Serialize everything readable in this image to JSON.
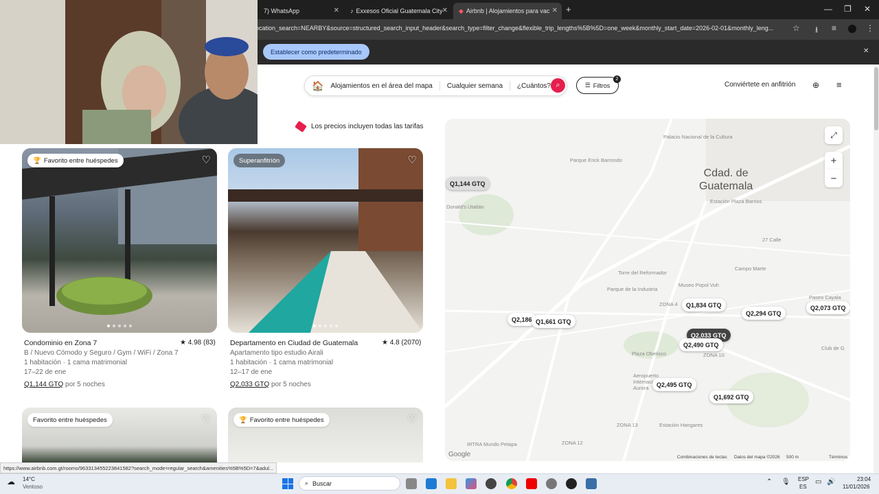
{
  "browser": {
    "tabs": [
      {
        "label": "7) WhatsApp",
        "active": false
      },
      {
        "label": "Exxesos Oficial Guatemala City",
        "active": false
      },
      {
        "label": "Airbnb | Alojamientos para vac",
        "active": true
      }
    ],
    "url": "ocation_search=NEARBY&source=structured_search_input_header&search_type=filter_change&flexible_trip_lengths%5B%5D=one_week&monthly_start_date=2026-02-01&monthly_leng...",
    "default_button": "Establecer como predeterminado",
    "status_url": "https://www.airbnb.com.gt/rooms/963313455223841582?search_mode=regular_search&amenities%5B%5D=7&adul..."
  },
  "header": {
    "location": "Alojamientos en el área del mapa",
    "dates": "Cualquier semana",
    "guests": "¿Cuántos?",
    "filters_label": "Filtros",
    "filters_count": "2",
    "host_link": "Conviértete en anfitrión"
  },
  "price_note": "Los precios incluyen todas las tarifas",
  "listings": [
    {
      "badge": "Favorito entre huéspedes",
      "title": "Condominio en Zona 7",
      "rating": "★ 4.98 (83)",
      "subtitle": "B / Nuevo Cómodo y Seguro / Gym / WiFi / Zona 7",
      "beds": "1 habitación · 1 cama matrimonial",
      "dates": "17–22 de ene",
      "price": "Q1,144 GTQ",
      "nights": "por 5 noches"
    },
    {
      "badge": "Superanfitrión",
      "title": "Departamento en Ciudad de Guatemala",
      "rating": "★ 4.8 (2070)",
      "subtitle": "Apartamento tipo estudio Airali",
      "beds": "1 habitación · 1 cama matrimonial",
      "dates": "12–17 de ene",
      "price": "Q2,033 GTQ",
      "nights": "por 5 noches"
    },
    {
      "badge": "Favorito entre huéspedes"
    },
    {
      "badge": "Favorito entre huéspedes"
    }
  ],
  "map": {
    "city_label": "Cdad. de Guatemala",
    "places": [
      "Palacio Nacional de la Cultura",
      "Parque Erick Barrondo",
      "Estación Plaza Barrios",
      "27 Calle",
      "Torre del Reformador",
      "Campo Marte",
      "Parque de la Industria",
      "Museo Popol Vuh",
      "ZONA 4",
      "ZONA 10",
      "Paseo Cayala",
      "Club de G",
      "Plaza Obelisco",
      "Aeropuerto Internacional La Aurora",
      "ZONA 13",
      "Estación Hangares",
      "IRTRA Mundo Petapa",
      "ZONA 12",
      "Donald's Utatlán",
      "Google"
    ],
    "pins": [
      {
        "label": "Q1,144 GTQ"
      },
      {
        "label": "Q1,834 GTQ"
      },
      {
        "label": "Q2,294 GTQ"
      },
      {
        "label": "Q2,073 GTQ"
      },
      {
        "label": "Q2,186"
      },
      {
        "label": "Q1,661 GTQ"
      },
      {
        "label": "Q2,033 GTQ"
      },
      {
        "label": "Q2,490 GTQ"
      },
      {
        "label": "Q2,495 GTQ"
      },
      {
        "label": "Q1,692 GTQ"
      }
    ],
    "footer": [
      "Combinaciones de teclas",
      "Datos del mapa ©2026",
      "500 m",
      "Términos"
    ]
  },
  "taskbar": {
    "weather_temp": "14°C",
    "weather_desc": "Ventoso",
    "search": "Buscar",
    "lang1": "ESP",
    "lang2": "ES",
    "time": "23:04",
    "date": "11/01/2026"
  }
}
